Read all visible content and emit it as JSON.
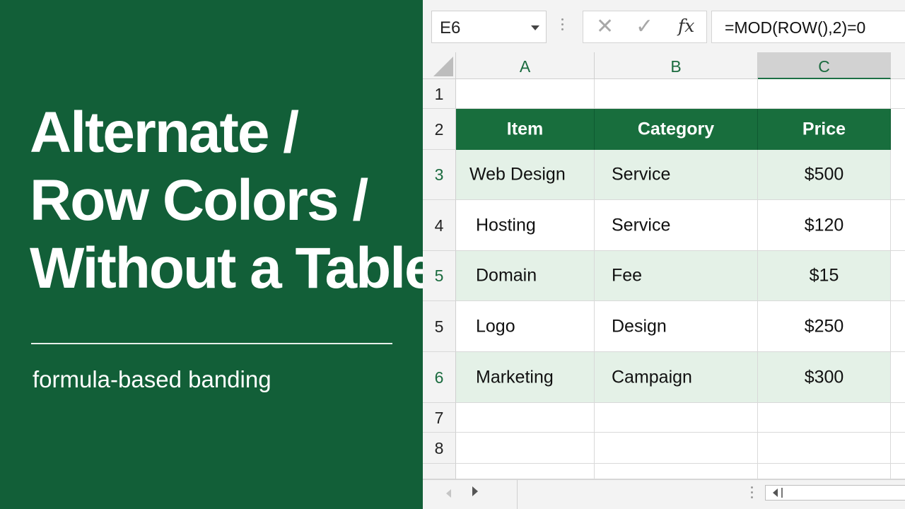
{
  "title_panel": {
    "title_lines": [
      "Alternate /",
      "Row Colors /",
      "Without a Table"
    ],
    "subtitle": "formula-based banding",
    "background": "#125f38"
  },
  "formula_bar": {
    "name_box": "E6",
    "cancel_symbol": "✕",
    "enter_symbol": "✓",
    "function_symbol": "fx",
    "formula": "=MOD(ROW(),2)=0"
  },
  "columns": [
    {
      "label": "A",
      "selected": false
    },
    {
      "label": "B",
      "selected": false
    },
    {
      "label": "C",
      "selected": true
    }
  ],
  "rows": [
    {
      "num": "1",
      "cells": [
        "",
        "",
        ""
      ],
      "style": "empty"
    },
    {
      "num": "2",
      "cells": [
        "Item",
        "Category",
        "Price"
      ],
      "style": "header"
    },
    {
      "num": "3",
      "cells": [
        "Web Design",
        "Service",
        "$500"
      ],
      "style": "band"
    },
    {
      "num": "4",
      "cells": [
        "Hosting",
        "Service",
        "$120"
      ],
      "style": "plain"
    },
    {
      "num": "5",
      "cells": [
        "Domain",
        "Fee",
        "$15"
      ],
      "style": "band"
    },
    {
      "num": "5",
      "cells": [
        "Logo",
        "Design",
        "$250"
      ],
      "style": "plain"
    },
    {
      "num": "6",
      "cells": [
        "Marketing",
        "Campaign",
        "$300"
      ],
      "style": "band"
    },
    {
      "num": "7",
      "cells": [
        "",
        "",
        ""
      ],
      "style": "empty"
    },
    {
      "num": "8",
      "cells": [
        "",
        "",
        ""
      ],
      "style": "empty"
    },
    {
      "num": "",
      "cells": [
        "",
        "",
        ""
      ],
      "style": "empty"
    }
  ],
  "colors": {
    "header_fill": "#186e3d",
    "band_fill": "#e4f1e7",
    "accent_text": "#1b6b3f"
  },
  "icons": {
    "name_box_dropdown": "chevron-down-icon",
    "scroll_left": "triangle-left-icon",
    "scroll_right": "triangle-right-icon"
  }
}
